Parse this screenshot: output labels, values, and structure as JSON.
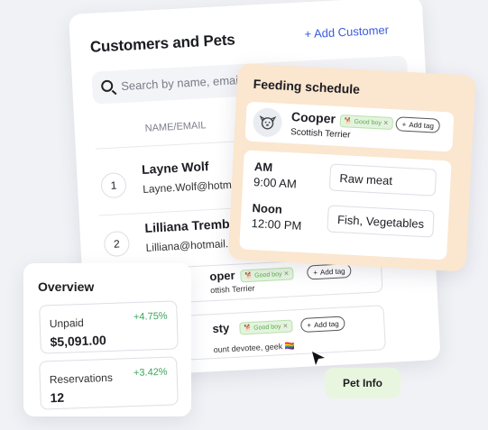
{
  "customers": {
    "title": "Customers and Pets",
    "add_label": "+ Add Customer",
    "search_placeholder": "Search by name, email",
    "column_name": "NAME/EMAIL",
    "rows": [
      {
        "num": "1",
        "name": "Layne Wolf",
        "email": "Layne.Wolf@hotm"
      },
      {
        "num": "2",
        "name": "Lilliana Trembla",
        "email": "Lilliana@hotmail.c"
      }
    ],
    "pets": [
      {
        "name": "oper",
        "breed": "ottish Terrier",
        "tag": "Good boy",
        "add_tag": "Add tag"
      },
      {
        "name": "sty",
        "breed": "ount devotee, geek",
        "tag": "Good boy",
        "add_tag": "Add tag"
      }
    ]
  },
  "feeding": {
    "title": "Feeding schedule",
    "pet": {
      "name": "Cooper",
      "breed": "Scottish Terrier",
      "tag": "Good boy",
      "add_tag": "Add tag"
    },
    "schedule": [
      {
        "label": "AM",
        "time": "9:00 AM",
        "food": "Raw meat"
      },
      {
        "label": "Noon",
        "time": "12:00 PM",
        "food": "Fish, Vegetables"
      }
    ]
  },
  "overview": {
    "title": "Overview",
    "stats": [
      {
        "label": "Unpaid",
        "delta": "+4.75%",
        "value": "$5,091.00"
      },
      {
        "label": "Reservations",
        "delta": "+3.42%",
        "value": "12"
      }
    ]
  },
  "pet_info_label": "Pet Info",
  "colors": {
    "accent": "#3b5bdb",
    "feeding_bg": "#fbe6cf",
    "positive": "#3ba55c",
    "tag_green": "#5fa84d",
    "chip_bg": "#e9f6df"
  }
}
